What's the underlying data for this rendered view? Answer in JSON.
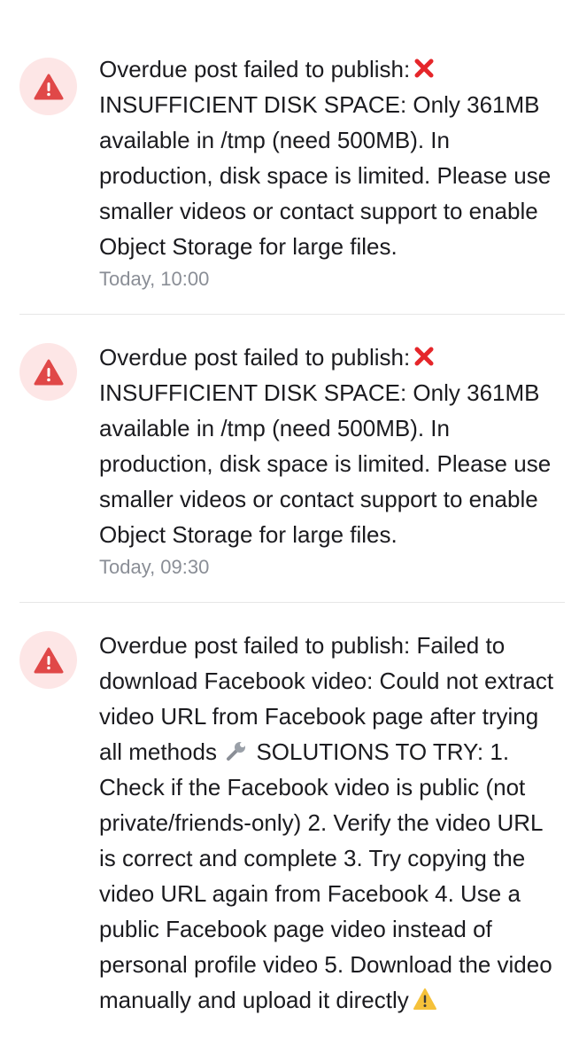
{
  "notifications": [
    {
      "icon": "warning-triangle-icon",
      "message_prefix": "Overdue post failed to publish:",
      "status_icon": "cross-mark-icon",
      "message_body": "INSUFFICIENT DISK SPACE: Only 361MB available in /tmp (need 500MB). In production, disk space is limited. Please use smaller videos or contact support to enable Object Storage for large files.",
      "timestamp": "Today, 10:00"
    },
    {
      "icon": "warning-triangle-icon",
      "message_prefix": "Overdue post failed to publish:",
      "status_icon": "cross-mark-icon",
      "message_body": "INSUFFICIENT DISK SPACE: Only 361MB available in /tmp (need 500MB). In production, disk space is limited. Please use smaller videos or contact support to enable Object Storage for large files.",
      "timestamp": "Today, 09:30"
    },
    {
      "icon": "warning-triangle-icon",
      "message_part1": "Overdue post failed to publish: Failed to download Facebook video: Could not extract video URL from Facebook page after trying all methods",
      "inline_icon1": "wrench-icon",
      "message_part2": "SOLUTIONS TO TRY: 1. Check if the Facebook video is public (not private/friends-only) 2. Verify the video URL is correct and complete 3. Try copying the video URL again from Facebook 4. Use a public Facebook page video instead of personal profile video 5. Download the video manually and upload it directly",
      "inline_icon2": "warning-sign-icon"
    }
  ],
  "colors": {
    "icon_background": "#fde6e6",
    "icon_red": "#e04848",
    "message_text": "#1b1b1f",
    "timestamp_text": "#8a8e96",
    "divider": "#e6e6e6",
    "cross_red": "#e5262a",
    "warning_yellow": "#f5c13a"
  }
}
